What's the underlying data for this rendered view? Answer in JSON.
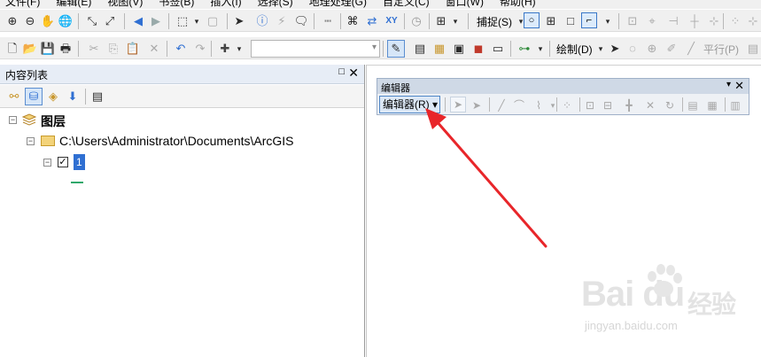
{
  "menu": [
    "文件(F)",
    "编辑(E)",
    "视图(V)",
    "书签(B)",
    "插入(I)",
    "选择(S)",
    "地理处理(G)",
    "自定义(C)",
    "窗口(W)",
    "帮助(H)"
  ],
  "toolbar1": {
    "snap_label": "捕捉(S)"
  },
  "toolbar2": {
    "draw_label": "绘制(D)",
    "parallel_label": "平行(P)"
  },
  "toc": {
    "title": "内容列表",
    "pin_glyph": "□",
    "close_glyph": "✕",
    "tree": {
      "root_label": "图层",
      "folder_path": "C:\\Users\\Administrator\\Documents\\ArcGIS",
      "layer_name": "1"
    }
  },
  "editor": {
    "title": "编辑器",
    "button_label": "编辑器(R) ▾",
    "dropdown_glyph": "▾",
    "close_glyph": "✕"
  },
  "watermark": {
    "brand": "Bai du",
    "sub": "jingyan.baidu.com",
    "jingyan": "经验"
  },
  "annotation": {
    "arrow_color": "#e8262a"
  }
}
